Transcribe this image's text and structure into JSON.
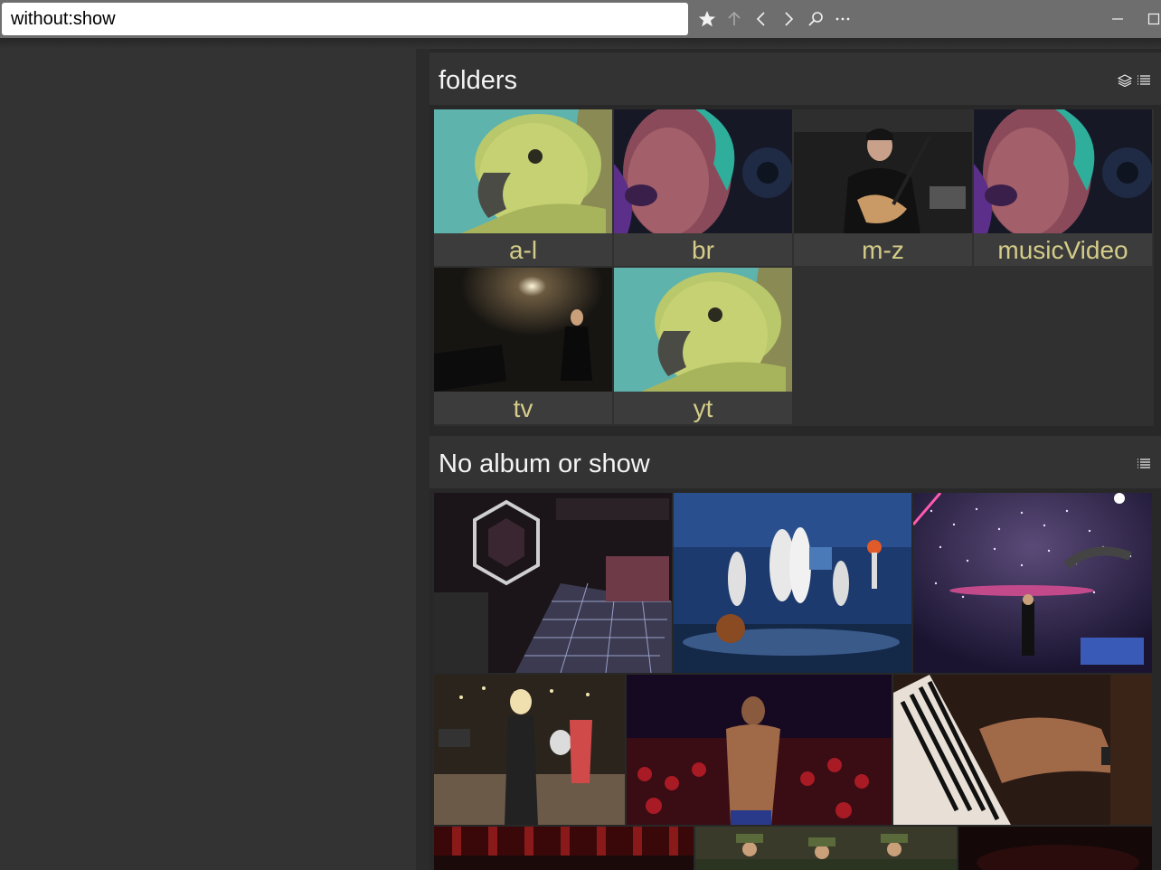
{
  "browser": {
    "url": "without:show",
    "buttons": {
      "bookmark": "star-icon",
      "up": "arrow-up-icon",
      "back": "chevron-left-icon",
      "forward": "chevron-right-icon",
      "search": "search-icon",
      "more": "ellipsis-icon",
      "minimize": "minimize-icon",
      "maximize": "maximize-icon"
    }
  },
  "sections": {
    "folders": {
      "title": "folders",
      "items": [
        {
          "label": "a-l",
          "thumb": "parrot"
        },
        {
          "label": "br",
          "thumb": "singer-closeup"
        },
        {
          "label": "m-z",
          "thumb": "guitarist"
        },
        {
          "label": "musicVideo",
          "thumb": "singer-closeup"
        },
        {
          "label": "tv",
          "thumb": "stage-piano"
        },
        {
          "label": "yt",
          "thumb": "parrot"
        }
      ]
    },
    "no_album": {
      "title": "No album or show",
      "videos": [
        {
          "thumb": "opole-stage"
        },
        {
          "thumb": "tv-studio-dancers"
        },
        {
          "thumb": "sparkle-stage-singer"
        },
        {
          "thumb": "band-performance"
        },
        {
          "thumb": "boxer"
        },
        {
          "thumb": "piano-hands"
        },
        {
          "thumb": "red-choir"
        },
        {
          "thumb": "military-choir"
        },
        {
          "thumb": "dark-stage"
        }
      ]
    }
  },
  "colors": {
    "accent_label": "#d4cc88",
    "background": "#333333",
    "panel": "#282828"
  }
}
